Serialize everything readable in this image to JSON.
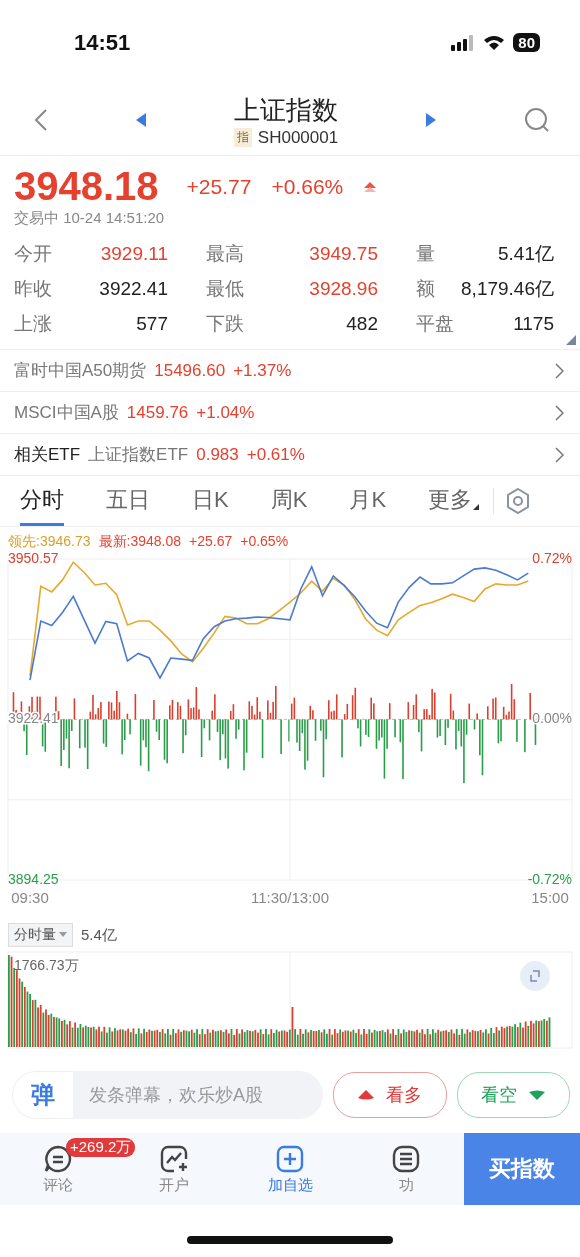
{
  "status_bar": {
    "time": "14:51",
    "battery": "80"
  },
  "header": {
    "title": "上证指数",
    "badge": "指",
    "code": "SH000001"
  },
  "quote": {
    "price": "3948.18",
    "change": "+25.77",
    "change_pct": "+0.66%",
    "status": "交易中 10-24 14:51:20"
  },
  "stats": [
    {
      "label": "今开",
      "value": "3929.11",
      "kind": "up"
    },
    {
      "label": "最高",
      "value": "3949.75",
      "kind": "up"
    },
    {
      "label": "量",
      "value": "5.41亿",
      "kind": "plain"
    },
    {
      "label": "昨收",
      "value": "3922.41",
      "kind": "plain"
    },
    {
      "label": "最低",
      "value": "3928.96",
      "kind": "up"
    },
    {
      "label": "额",
      "value": "8,179.46亿",
      "kind": "plain"
    },
    {
      "label": "上涨",
      "value": "577",
      "kind": "plain"
    },
    {
      "label": "下跌",
      "value": "482",
      "kind": "plain"
    },
    {
      "label": "平盘",
      "value": "1175",
      "kind": "plain"
    }
  ],
  "related": [
    {
      "name": "富时中国A50期货",
      "price": "15496.60",
      "change": "+1.37%"
    },
    {
      "name": "MSCI中国A股",
      "price": "1459.76",
      "change": "+1.04%"
    },
    {
      "label": "相关ETF",
      "name": "上证指数ETF",
      "price": "0.983",
      "change": "+0.61%"
    }
  ],
  "tabs": [
    {
      "label": "分时",
      "selected": true,
      "dropdown": false
    },
    {
      "label": "五日",
      "selected": false,
      "dropdown": false
    },
    {
      "label": "日K",
      "selected": false,
      "dropdown": false
    },
    {
      "label": "周K",
      "selected": false,
      "dropdown": false
    },
    {
      "label": "月K",
      "selected": false,
      "dropdown": false
    },
    {
      "label": "更多",
      "selected": false,
      "dropdown": true
    }
  ],
  "chart": {
    "lead_value": ":3946.73",
    "latest_value": ":3948.08",
    "latest_change": "+25.67",
    "latest_pct": "+0.65%",
    "right_labels": [
      "0.72%",
      "0.00%",
      "-0.72%"
    ],
    "chart_data": {
      "type": "line",
      "categories": [
        "09:30",
        null,
        null,
        null,
        null,
        null,
        null,
        null,
        null,
        null,
        null,
        null,
        null,
        null,
        null,
        null,
        null,
        null,
        null,
        null,
        null,
        null,
        null,
        null,
        "11:30/13:00",
        null,
        null,
        null,
        null,
        null,
        null,
        null,
        null,
        null,
        null,
        null,
        null,
        null,
        null,
        null,
        null,
        null,
        null,
        null,
        null,
        null,
        null,
        null,
        "15:00"
      ],
      "ylim": [
        3894.25,
        3950.57
      ],
      "yticks": [
        {
          "value": 3950.57,
          "label": "3950.57"
        },
        {
          "value": 3922.41,
          "label": "3922.41"
        },
        {
          "value": 3894.25,
          "label": "3894.25"
        }
      ],
      "series": [
        {
          "name": "领先",
          "color": "#e6a92c",
          "values": [
            3930.0,
            3945.8,
            3944.8,
            3946.9,
            3950.0,
            3948.2,
            3946.0,
            3946.3,
            3944.3,
            3939.0,
            3939.7,
            3939.7,
            3938.1,
            3936.2,
            3933.9,
            3932.5,
            3934.9,
            3937.6,
            3940.5,
            3940.2,
            3939.2,
            3939.2,
            3940.1,
            3941.5,
            3943.0,
            3944.6,
            3946.7,
            3944.9,
            3947.2,
            3946.0,
            3943.4,
            3940.0,
            3938.1,
            3937.1,
            3939.9,
            3941.2,
            3942.4,
            3942.9,
            3943.6,
            3944.4,
            3943.8,
            3943.1,
            3945.3,
            3946.2,
            3946.0,
            3946.0,
            3946.7,
            null,
            null
          ]
        },
        {
          "name": "最新",
          "color": "#4a7bd0",
          "values": [
            3929.3,
            3939.7,
            3938.9,
            3941.2,
            3944.0,
            3939.9,
            3935.8,
            3939.6,
            3939.2,
            3932.7,
            3934.0,
            3933.2,
            3929.7,
            3933.2,
            3933.0,
            3932.8,
            3936.6,
            3938.7,
            3939.7,
            3940.1,
            3940.2,
            3940.4,
            3940.3,
            3940.1,
            3939.9,
            3945.3,
            3949.2,
            3944.1,
            3947.6,
            3945.9,
            3943.9,
            3941.4,
            3939.3,
            3938.5,
            3943.0,
            3945.6,
            3947.4,
            3946.2,
            3946.2,
            3946.4,
            3947.6,
            3948.8,
            3949.0,
            3948.6,
            3947.8,
            3946.9,
            3948.1,
            null,
            null
          ]
        }
      ]
    }
  },
  "volume": {
    "selector": "分时量",
    "total": "5.4亿",
    "max_label": "1766.73万"
  },
  "danmaku": {
    "icon_text": "弹",
    "placeholder": "发条弹幕，欢乐炒A股"
  },
  "sentiment": [
    {
      "label": "看多",
      "kind": "bull"
    },
    {
      "label": "看空",
      "kind": "bear"
    }
  ],
  "bottom_nav": [
    {
      "label": "评论",
      "kind": "comment",
      "highlight": false,
      "badge": "+269.2万"
    },
    {
      "label": "开户",
      "kind": "account",
      "highlight": false
    },
    {
      "label": "加自选",
      "kind": "add",
      "highlight": true
    },
    {
      "label": "功",
      "kind": "menu",
      "highlight": false
    }
  ],
  "buy_button": "买指数"
}
